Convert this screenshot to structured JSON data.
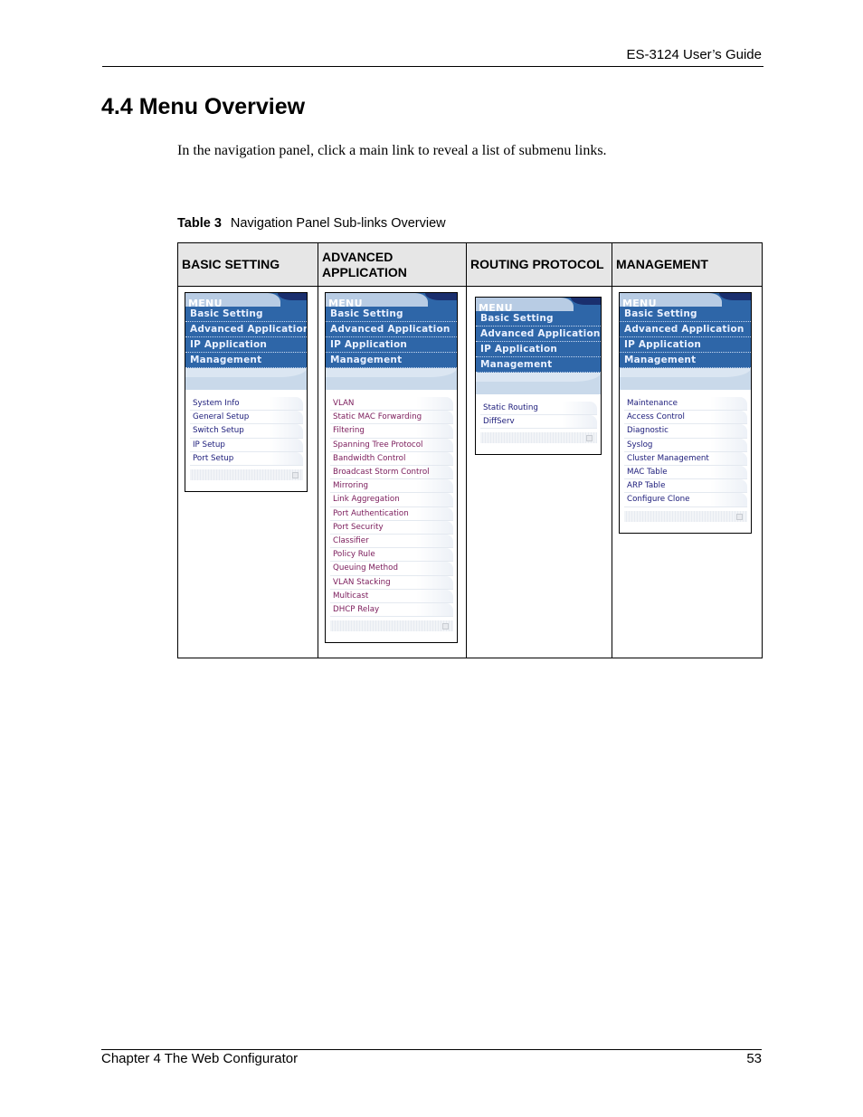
{
  "header": {
    "guide_title": "ES-3124 User’s Guide"
  },
  "section": {
    "title": "4.4  Menu Overview",
    "intro": "In the navigation panel, click a main link to reveal a list of submenu links."
  },
  "table": {
    "caption_label": "Table 3",
    "caption_text": "Navigation Panel Sub-links Overview",
    "columns": [
      {
        "header": "BASIC SETTING"
      },
      {
        "header": "ADVANCED APPLICATION"
      },
      {
        "header": "ROUTING PROTOCOL"
      },
      {
        "header": "MANAGEMENT"
      }
    ]
  },
  "menu": {
    "title": "MENU",
    "main_links": [
      "Basic Setting",
      "Advanced Application",
      "IP Application",
      "Management"
    ],
    "colors": {
      "panel_blue": "#2e66a8",
      "sublink_purple": "#7a1a5a",
      "sublink_blue": "#1b1b7a"
    }
  },
  "panels": {
    "basic_setting": [
      "System Info",
      "General Setup",
      "Switch Setup",
      "IP Setup",
      "Port Setup"
    ],
    "advanced_application": [
      "VLAN",
      "Static MAC Forwarding",
      "Filtering",
      "Spanning Tree Protocol",
      "Bandwidth Control",
      "Broadcast Storm Control",
      "Mirroring",
      "Link Aggregation",
      "Port Authentication",
      "Port Security",
      "Classifier",
      "Policy Rule",
      "Queuing Method",
      "VLAN Stacking",
      "Multicast",
      "DHCP Relay"
    ],
    "routing_protocol": [
      "Static Routing",
      "DiffServ"
    ],
    "management": [
      "Maintenance",
      "Access Control",
      "Diagnostic",
      "Syslog",
      "Cluster Management",
      "MAC Table",
      "ARP Table",
      "Configure Clone"
    ]
  },
  "footer": {
    "chapter": "Chapter 4 The Web Configurator",
    "page_number": "53"
  }
}
